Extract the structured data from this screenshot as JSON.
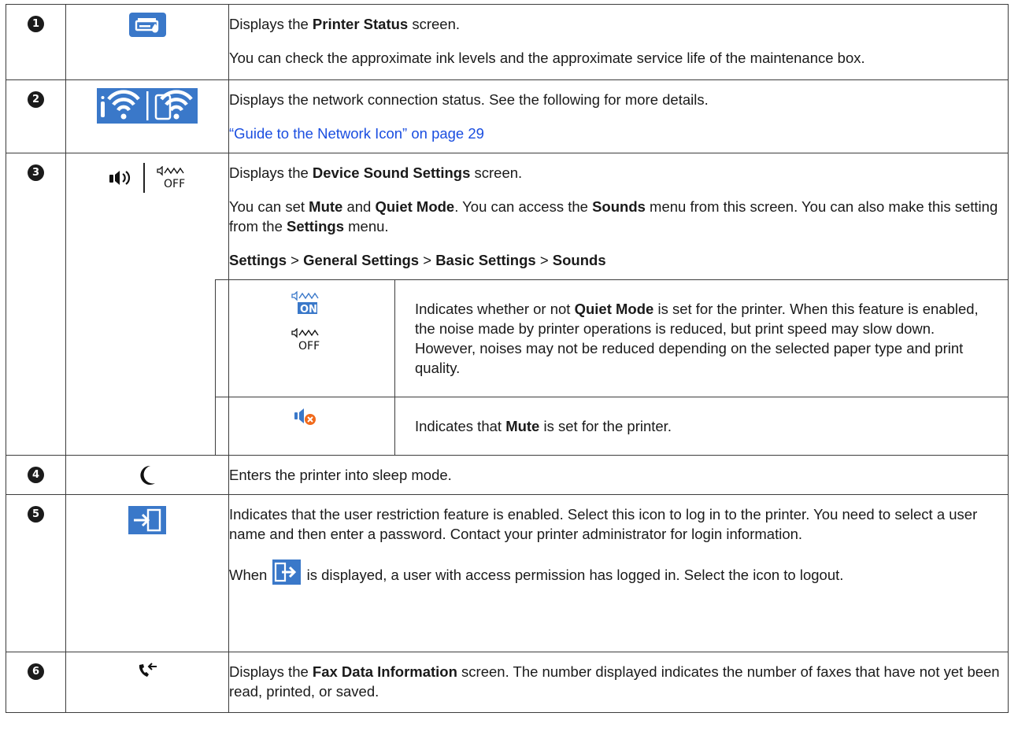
{
  "rows": [
    {
      "number": "1",
      "icon": "printer-status-icon",
      "paragraphs": [
        {
          "pre": "Displays the ",
          "bold": "Printer Status",
          "post": " screen."
        },
        {
          "text": "You can check the approximate ink levels and the approximate service life of the maintenance box."
        }
      ]
    },
    {
      "number": "2",
      "icon": "wifi-status-icon",
      "paragraphs": [
        {
          "text": "Displays the network connection status. See the following for more details."
        },
        {
          "link": "“Guide to the Network Icon” on page 29"
        }
      ]
    },
    {
      "number": "3",
      "icon": "speaker-icon",
      "paragraphs": [
        {
          "pre": "Displays the ",
          "bold": "Device Sound Settings",
          "post": " screen."
        },
        {
          "segments": [
            "You can set ",
            "Mute",
            " and ",
            "Quiet Mode",
            ". You can access the ",
            "Sounds",
            " menu from this screen. You can also make this setting from the ",
            "Settings",
            " menu."
          ]
        },
        {
          "path": [
            "Settings",
            " > ",
            "General Settings",
            " > ",
            "Basic Settings",
            " > ",
            "Sounds"
          ]
        }
      ],
      "sub": [
        {
          "icon_on_label": "ON",
          "icon_off_label": "OFF",
          "segments": [
            "Indicates whether or not ",
            "Quiet Mode",
            " is set for the printer. When this feature is enabled, the noise made by printer operations is reduced, but print speed may slow down. However, noises may not be reduced depending on the selected paper type and print quality."
          ]
        },
        {
          "segments": [
            "Indicates that ",
            "Mute",
            " is set for the printer."
          ]
        }
      ]
    },
    {
      "number": "4",
      "icon": "moon-icon",
      "paragraphs": [
        {
          "text": "Enters the printer into sleep mode."
        }
      ]
    },
    {
      "number": "5",
      "icon": "login-icon",
      "paragraphs": [
        {
          "text": "Indicates that the user restriction feature is enabled. Select this icon to log in to the printer. You need to select a user name and then enter a password. Contact your printer administrator for login information."
        },
        {
          "pre": "When ",
          "post": " is displayed, a user with access permission has logged in. Select the icon to logout."
        }
      ]
    },
    {
      "number": "6",
      "icon": "fax-icon",
      "paragraphs": [
        {
          "pre": "Displays the ",
          "bold": "Fax Data Information",
          "post": " screen. The number displayed indicates the number of faxes that have not yet been read, printed, or saved."
        }
      ]
    }
  ],
  "colors": {
    "icon_blue": "#3a78c9",
    "accent_blue": "#1a4ee0",
    "mute_orange": "#f06a1c"
  }
}
